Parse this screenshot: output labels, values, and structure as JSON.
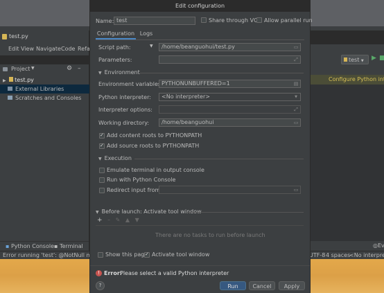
{
  "ide": {
    "file_tab": "test.py",
    "menu": [
      "Edit",
      "View",
      "Navigate",
      "Code",
      "Refa"
    ],
    "project_label": "Project",
    "tree": [
      "test.py",
      "External Libraries",
      "Scratches and Consoles"
    ],
    "bottom_tabs": [
      "Python Console",
      "Terminal"
    ],
    "status_left": "Error running 'test': @NotNull meth",
    "status_right": [
      "UTF-8",
      "4 spaces",
      "<No interpreter>"
    ],
    "run_config": "test",
    "configure_banner": "Configure Python interpr",
    "event_log": "Ever"
  },
  "dialog": {
    "title": "Edit configuration",
    "name_label": "Name:",
    "name_value": "test",
    "share_vcs": "Share through VCS",
    "allow_parallel": "Allow parallel run",
    "tabs": [
      "Configuration",
      "Logs"
    ],
    "script_path_label": "Script path:",
    "script_path_value": "/home/beanguohui/test.py",
    "parameters_label": "Parameters:",
    "environment_section": "Environment",
    "env_vars_label": "Environment variables:",
    "env_vars_value": "PYTHONUNBUFFERED=1",
    "interpreter_label": "Python interpreter:",
    "interpreter_value": "<No interpreter>",
    "interp_options_label": "Interpreter options:",
    "workdir_label": "Working directory:",
    "workdir_value": "/home/beanguohui",
    "add_content_roots": "Add content roots to PYTHONPATH",
    "add_source_roots": "Add source roots to PYTHONPATH",
    "execution_section": "Execution",
    "emulate_terminal": "Emulate terminal in output console",
    "run_with_console": "Run with Python Console",
    "redirect_input": "Redirect input from:",
    "before_launch": "Before launch: Activate tool window",
    "no_tasks": "There are no tasks to run before launch",
    "show_page": "Show this page",
    "activate_tool_window": "Activate tool window",
    "error_bold": "Error:",
    "error_text": "Please select a valid Python interpreter",
    "buttons": {
      "run": "Run",
      "cancel": "Cancel",
      "apply": "Apply"
    },
    "help": "?"
  },
  "colors": {
    "accent": "#365880",
    "selection": "#0d293e",
    "error": "#c75450",
    "run_green": "#59a869"
  }
}
